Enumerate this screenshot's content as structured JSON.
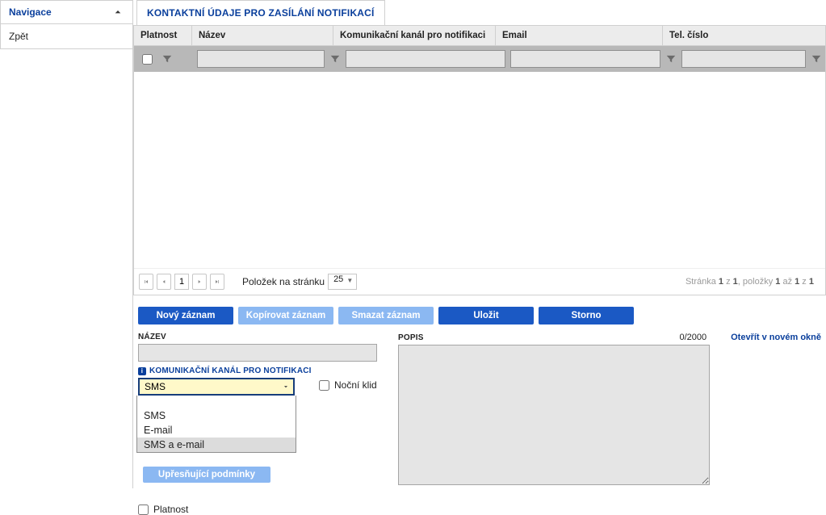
{
  "sidebar": {
    "title": "Navigace",
    "back_label": "Zpět"
  },
  "tab": {
    "title": "KONTAKTNÍ ÚDAJE PRO ZASÍLÁNÍ NOTIFIKACÍ"
  },
  "table": {
    "headers": {
      "platnost": "Platnost",
      "nazev": "Název",
      "kanal": "Komunikační kanál pro notifikaci",
      "email": "Email",
      "tel": "Tel. číslo"
    }
  },
  "pager": {
    "page": "1",
    "per_page_label": "Položek na stránku",
    "per_page_value": "25",
    "info_prefix": "Stránka ",
    "info_page": "1",
    "info_mid1": " z ",
    "info_total_pages": "1",
    "info_mid2": ", položky ",
    "info_from": "1",
    "info_mid3": " až ",
    "info_to": "1",
    "info_mid4": " z ",
    "info_total": "1"
  },
  "buttons": {
    "novy": "Nový záznam",
    "kopirovat": "Kopírovat záznam",
    "smazat": "Smazat záznam",
    "ulozit": "Uložit",
    "storno": "Storno",
    "upresnujici": "Upřesňující podmínky"
  },
  "form": {
    "nazev_label": "NÁZEV",
    "kanal_label": "KOMUNIKAČNÍ KANÁL PRO NOTIFIKACI",
    "kanal_value": "SMS",
    "kanal_options": {
      "sms": "SMS",
      "email": "E-mail",
      "both": "SMS a e-mail"
    },
    "nocni_klid_label": "Noční klid",
    "platnost_label": "Platnost",
    "popis_label": "POPIS",
    "popis_counter": "0/2000",
    "open_new_label": "Otevřít v novém okně"
  }
}
